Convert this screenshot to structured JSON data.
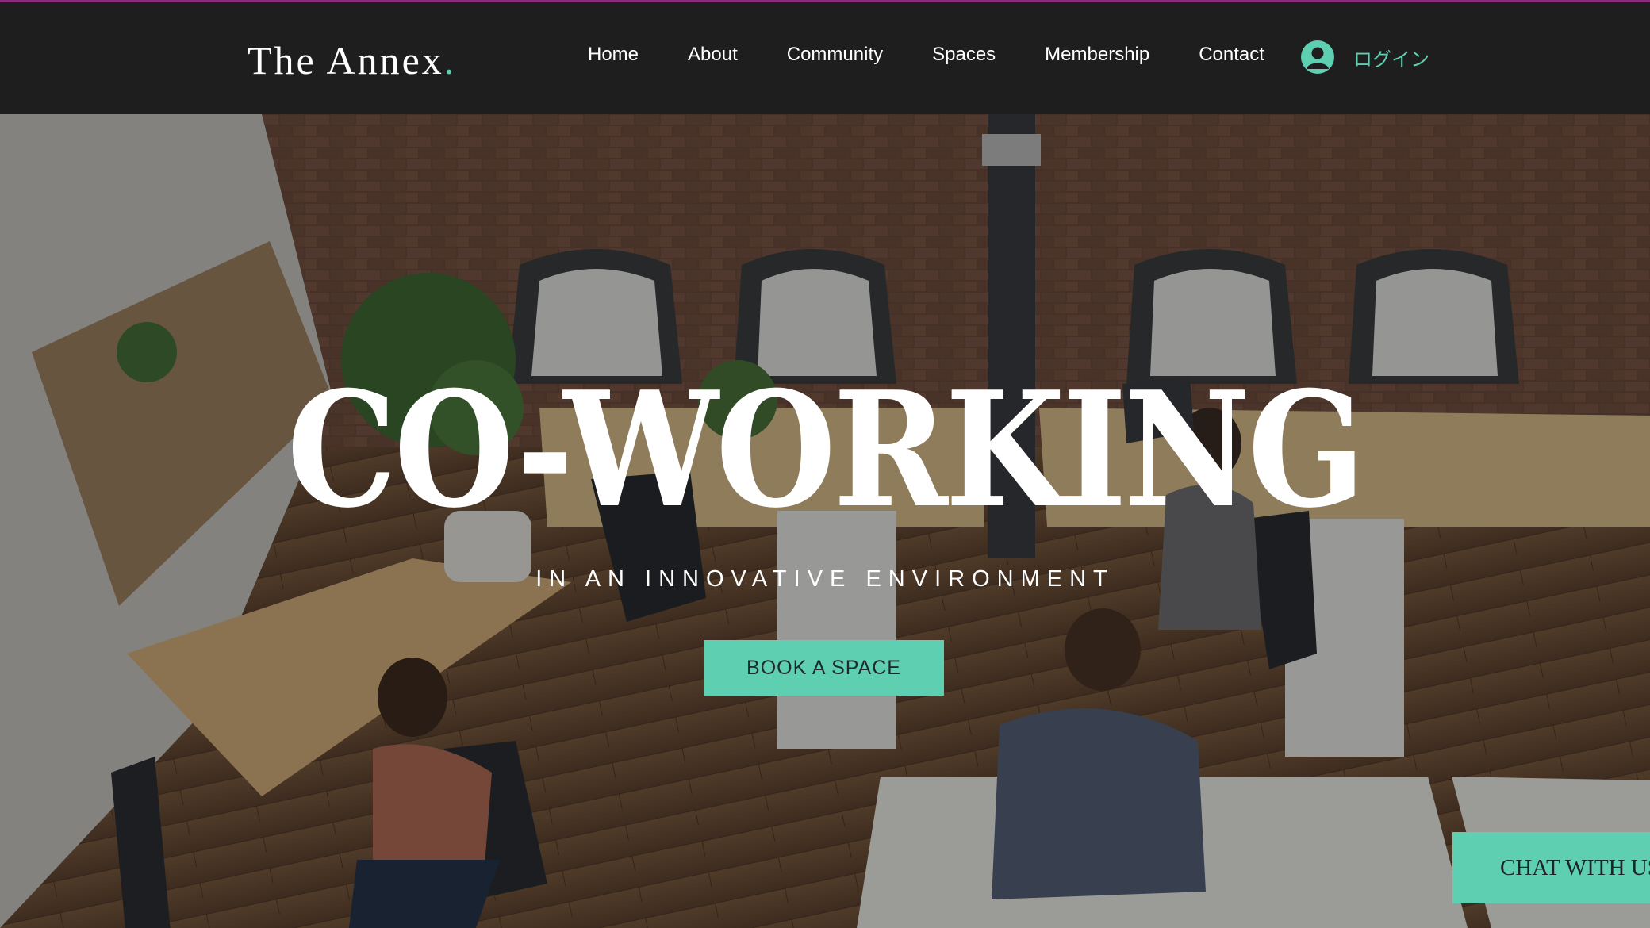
{
  "brand": {
    "logo_text": "The Annex",
    "logo_dot": ".",
    "accent_color": "#5fcfb2",
    "header_bg": "#1e1e1e"
  },
  "nav": {
    "items": [
      {
        "label": "Home"
      },
      {
        "label": "About"
      },
      {
        "label": "Community"
      },
      {
        "label": "Spaces"
      },
      {
        "label": "Membership"
      },
      {
        "label": "Contact"
      }
    ]
  },
  "login": {
    "icon": "user-avatar-icon",
    "label": "ログイン"
  },
  "hero": {
    "background_image": "open-plan co-working office with brick wall, arched windows and people working at desks",
    "title": "CO-WORKING",
    "subtitle": "IN AN INNOVATIVE ENVIRONMENT",
    "cta_label": "BOOK A SPACE"
  },
  "chat": {
    "label": "CHAT WITH US"
  }
}
